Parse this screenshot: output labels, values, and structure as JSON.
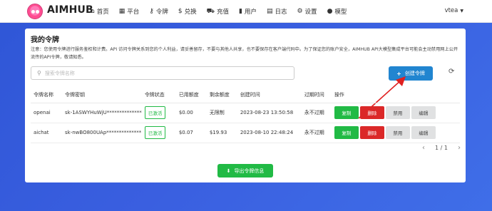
{
  "app": {
    "brand": "AIMHUB"
  },
  "nav": [
    {
      "icon": "home-icon",
      "glyph": "⌂",
      "label": "首页"
    },
    {
      "icon": "grid-icon",
      "glyph": "▦",
      "label": "平台"
    },
    {
      "icon": "key-icon",
      "glyph": "⚷",
      "label": "令牌"
    },
    {
      "icon": "dollar-icon",
      "glyph": "$",
      "label": "兑换"
    },
    {
      "icon": "cart-icon",
      "glyph": "⛟",
      "label": "充值"
    },
    {
      "icon": "user-icon",
      "glyph": "▮",
      "label": "用户"
    },
    {
      "icon": "book-icon",
      "glyph": "▤",
      "label": "日志"
    },
    {
      "icon": "gear-icon",
      "glyph": "⚙",
      "label": "设置"
    },
    {
      "icon": "info-icon",
      "glyph": "●",
      "label": "模型"
    }
  ],
  "user": {
    "name": "vtea"
  },
  "page": {
    "title": "我的令牌",
    "notice": "注意：您使用令牌进行服务鉴权和计费。API 访问令牌关系到您的个人利益，请妥善留存，不要与其他人共享，也不要保存在客户端代码中。为了保证您的账户安全，AIMHUB API大模型集成平台可能会主动禁用网上公开流传的API令牌，敬请知悉。",
    "search_placeholder": "搜索令牌名称",
    "create_label": "创建令牌",
    "export_label": "导出令牌信息"
  },
  "table": {
    "headers": [
      "令牌名称",
      "令牌密钥",
      "令牌状态",
      "已用额度",
      "剩余额度",
      "创建时间",
      "过期时间",
      "操作"
    ],
    "rows": [
      {
        "name": "openai",
        "key": "sk-1ASWYHuWjU**************",
        "status": "已激活",
        "used": "$0.00",
        "remaining": "无限制",
        "created": "2023-08-23 13:50:58",
        "expires": "永不过期"
      },
      {
        "name": "aichat",
        "key": "sk-nwBO800UAp**************",
        "status": "已激活",
        "used": "$0.07",
        "remaining": "$19.93",
        "created": "2023-08-10 22:48:24",
        "expires": "永不过期"
      }
    ],
    "actions": {
      "copy": "复制",
      "delete": "删除",
      "disable": "禁用",
      "edit": "编辑"
    }
  },
  "pager": {
    "text": "1 / 1"
  }
}
